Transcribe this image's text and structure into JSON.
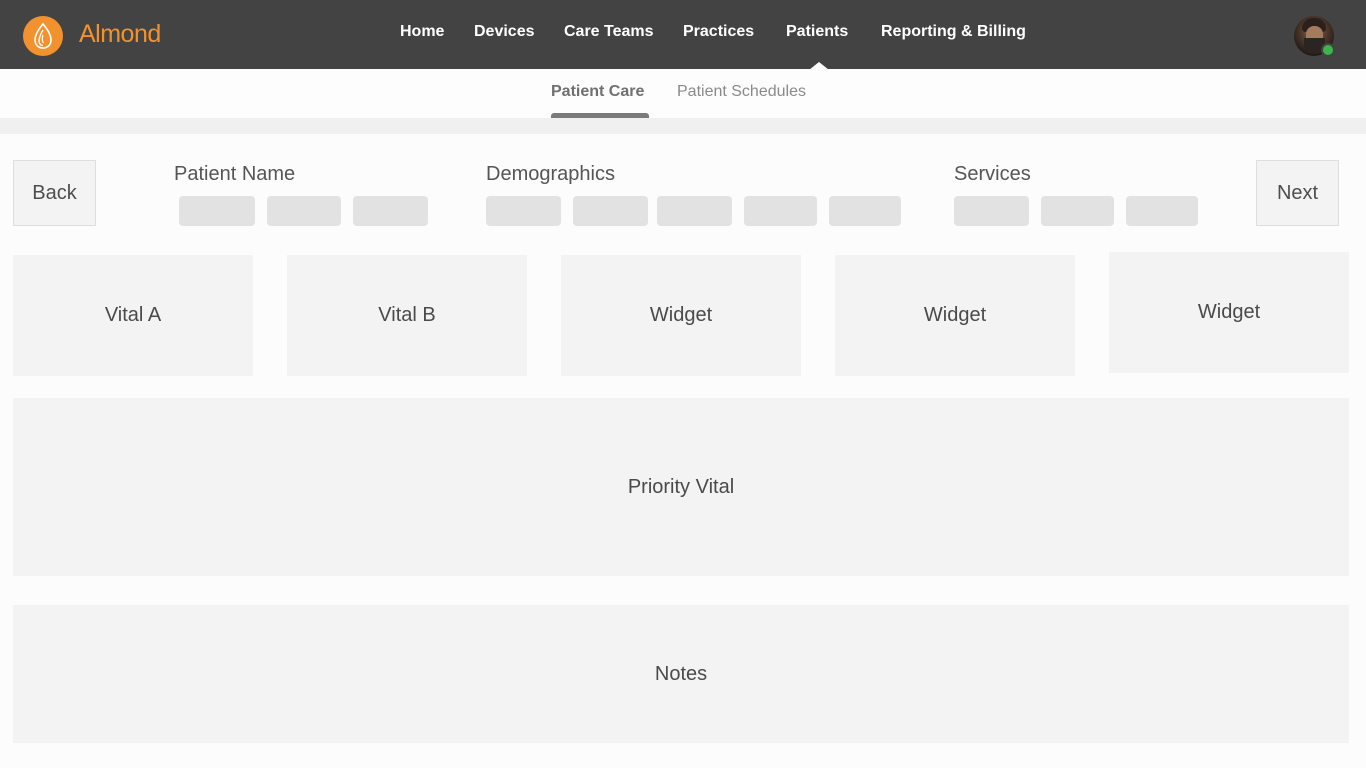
{
  "brand": {
    "name": "Almond",
    "accent_color": "#f2922f"
  },
  "header": {
    "nav_items": [
      "Home",
      "Devices",
      "Care Teams",
      "Practices",
      "Patients",
      "Reporting & Billing"
    ],
    "active_nav": "Patients",
    "user": {
      "avatar": "user-avatar",
      "status": "online",
      "status_color": "#3cb64a"
    }
  },
  "subnav": {
    "tabs": [
      "Patient Care",
      "Patient Schedules"
    ],
    "active_tab": "Patient Care"
  },
  "patient_header": {
    "back_label": "Back",
    "next_label": "Next",
    "sections": [
      {
        "title": "Patient Name",
        "placeholder_count": 3
      },
      {
        "title": "Demographics",
        "placeholder_count": 5
      },
      {
        "title": "Services",
        "placeholder_count": 3
      }
    ]
  },
  "widgets": [
    "Vital A",
    "Vital B",
    "Widget",
    "Widget",
    "Widget"
  ],
  "priority_panel": {
    "label": "Priority Vital"
  },
  "notes_panel": {
    "label": "Notes"
  }
}
